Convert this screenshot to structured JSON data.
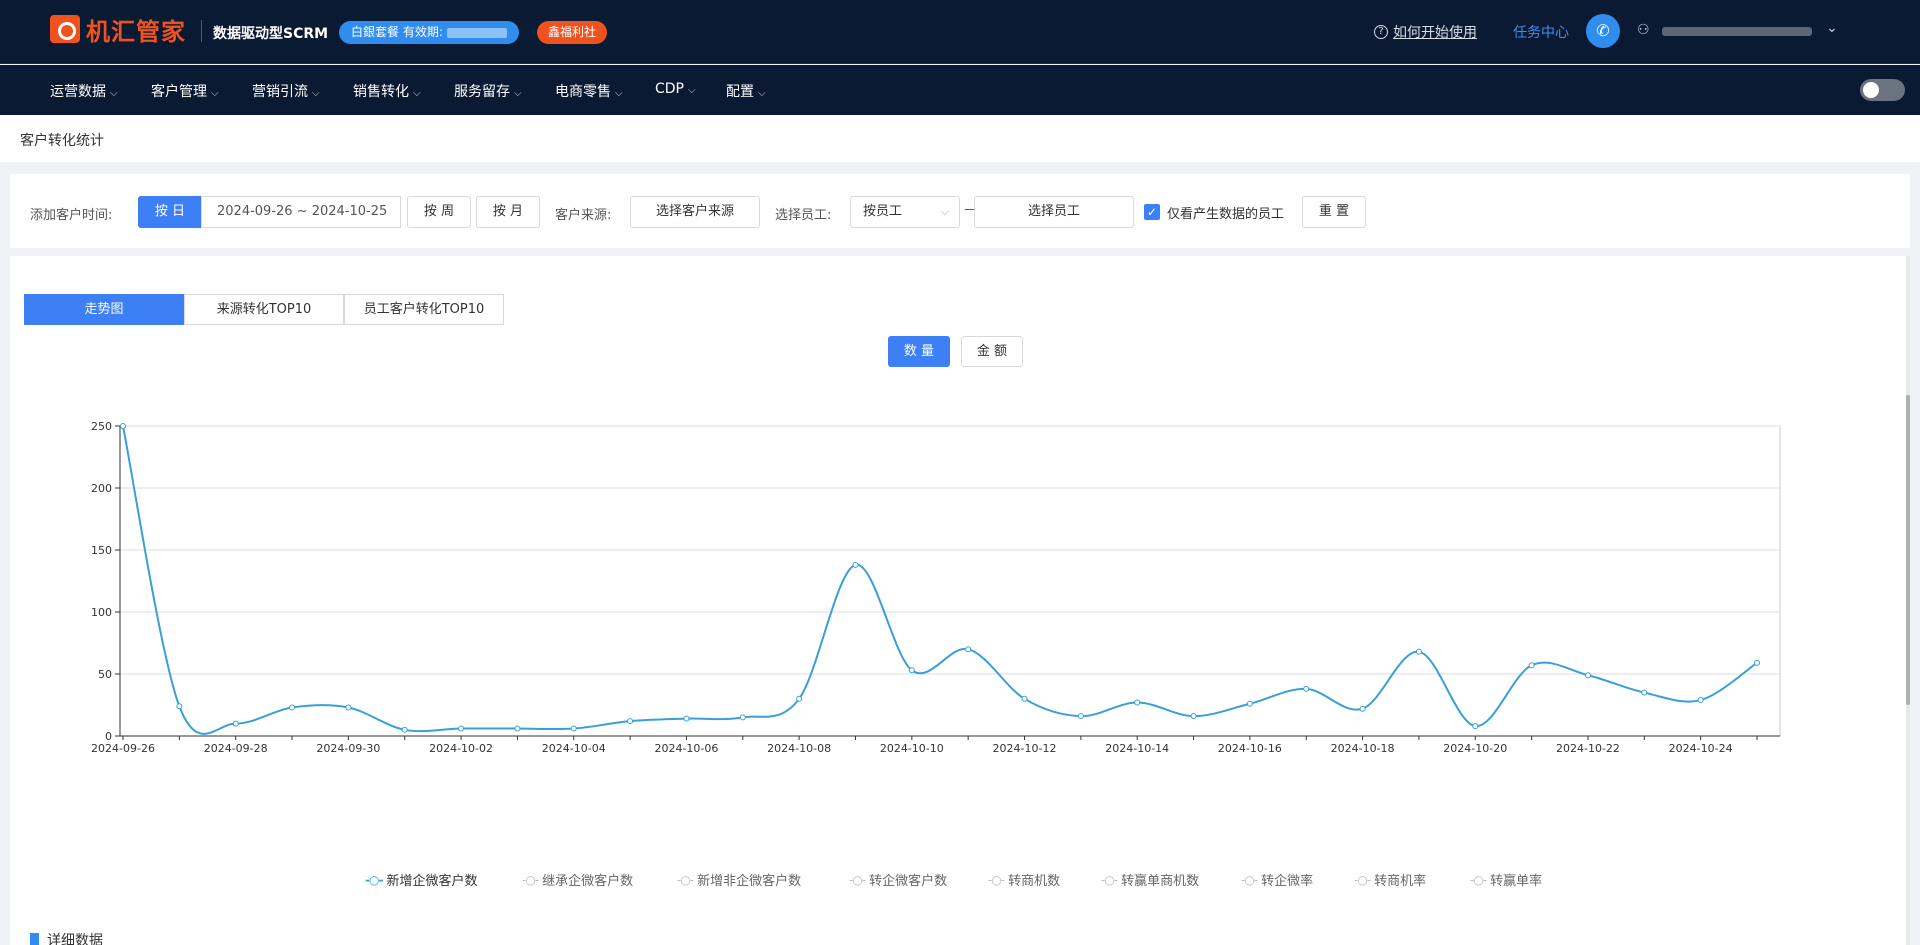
{
  "header": {
    "logo_text": "机汇管家",
    "subtitle": "数据驱动型SCRM",
    "package_label": "白銀套餐 有效期:",
    "benefit_label": "鑫福利社",
    "help_link": "如何开始使用",
    "task_center": "任务中心"
  },
  "nav": {
    "items": [
      {
        "label": "运营数据"
      },
      {
        "label": "客户管理"
      },
      {
        "label": "营销引流"
      },
      {
        "label": "销售转化"
      },
      {
        "label": "服务留存"
      },
      {
        "label": "电商零售"
      },
      {
        "label": "CDP"
      },
      {
        "label": "配置"
      }
    ]
  },
  "page": {
    "breadcrumb": "客户转化统计"
  },
  "filters": {
    "add_time_label": "添加客户时间:",
    "by_day": "按 日",
    "date_range": "2024-09-26 ~ 2024-10-25",
    "by_week": "按 周",
    "by_month": "按 月",
    "source_label": "客户来源:",
    "source_placeholder": "选择客户来源",
    "staff_label": "选择员工:",
    "staff_mode": "按员工",
    "dash": "—",
    "staff_placeholder": "选择员工",
    "only_data_label": "仅看产生数据的员工",
    "reset": "重 置"
  },
  "tabs": [
    {
      "label": "走势图",
      "active": true
    },
    {
      "label": "来源转化TOP10",
      "active": false
    },
    {
      "label": "员工客户转化TOP10",
      "active": false
    }
  ],
  "metric_toggle": {
    "count": "数 量",
    "amount": "金 额"
  },
  "chart_data": {
    "type": "line",
    "x": [
      "2024-09-26",
      "2024-09-27",
      "2024-09-28",
      "2024-09-29",
      "2024-09-30",
      "2024-10-01",
      "2024-10-02",
      "2024-10-03",
      "2024-10-04",
      "2024-10-05",
      "2024-10-06",
      "2024-10-07",
      "2024-10-08",
      "2024-10-09",
      "2024-10-10",
      "2024-10-11",
      "2024-10-12",
      "2024-10-13",
      "2024-10-14",
      "2024-10-15",
      "2024-10-16",
      "2024-10-17",
      "2024-10-18",
      "2024-10-19",
      "2024-10-20",
      "2024-10-21",
      "2024-10-22",
      "2024-10-23",
      "2024-10-24",
      "2024-10-25"
    ],
    "x_tick_labels": [
      "2024-09-26",
      "2024-09-28",
      "2024-09-30",
      "2024-10-02",
      "2024-10-04",
      "2024-10-06",
      "2024-10-08",
      "2024-10-10",
      "2024-10-12",
      "2024-10-14",
      "2024-10-16",
      "2024-10-18",
      "2024-10-20",
      "2024-10-22",
      "2024-10-24"
    ],
    "y_ticks": [
      0,
      50,
      100,
      150,
      200,
      250
    ],
    "ylim": [
      0,
      250
    ],
    "series": [
      {
        "name": "新增企微客户数",
        "color": "#3a9fd8",
        "values": [
          250,
          24,
          10,
          23,
          23,
          5,
          6,
          6,
          6,
          12,
          14,
          15,
          30,
          138,
          53,
          70,
          30,
          16,
          27,
          16,
          26,
          38,
          22,
          68,
          8,
          57,
          49,
          35,
          29,
          59
        ]
      }
    ],
    "legend": [
      {
        "name": "新增企微客户数",
        "on": true
      },
      {
        "name": "继承企微客户数",
        "on": false
      },
      {
        "name": "新增非企微客户数",
        "on": false
      },
      {
        "name": "转企微客户数",
        "on": false
      },
      {
        "name": "转商机数",
        "on": false
      },
      {
        "name": "转赢单商机数",
        "on": false
      },
      {
        "name": "转企微率",
        "on": false
      },
      {
        "name": "转商机率",
        "on": false
      },
      {
        "name": "转赢单率",
        "on": false
      }
    ],
    "grid": true
  },
  "detail": {
    "label": "详细数据"
  }
}
